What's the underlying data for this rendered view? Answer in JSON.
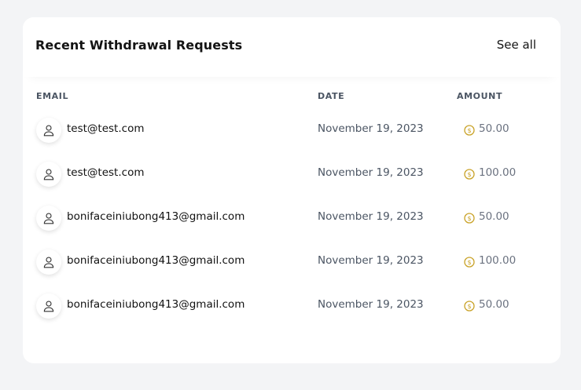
{
  "card": {
    "title": "Recent Withdrawal Requests",
    "see_all_label": "See all"
  },
  "table": {
    "columns": {
      "email": "EMAIL",
      "date": "DATE",
      "amount": "AMOUNT"
    },
    "rows": [
      {
        "email": "test@test.com",
        "date": "November 19, 2023",
        "amount": "50.00"
      },
      {
        "email": "test@test.com",
        "date": "November 19, 2023",
        "amount": "100.00"
      },
      {
        "email": "bonifaceiniubong413@gmail.com",
        "date": "November 19, 2023",
        "amount": "50.00"
      },
      {
        "email": "bonifaceiniubong413@gmail.com",
        "date": "November 19, 2023",
        "amount": "100.00"
      },
      {
        "email": "bonifaceiniubong413@gmail.com",
        "date": "November 19, 2023",
        "amount": "50.00"
      }
    ]
  },
  "icons": {
    "avatar": "user-icon",
    "currency": "coin-icon"
  },
  "colors": {
    "background": "#f3f4f6",
    "card": "#ffffff",
    "coin": "#c9a227",
    "header_text": "#4b5563"
  }
}
